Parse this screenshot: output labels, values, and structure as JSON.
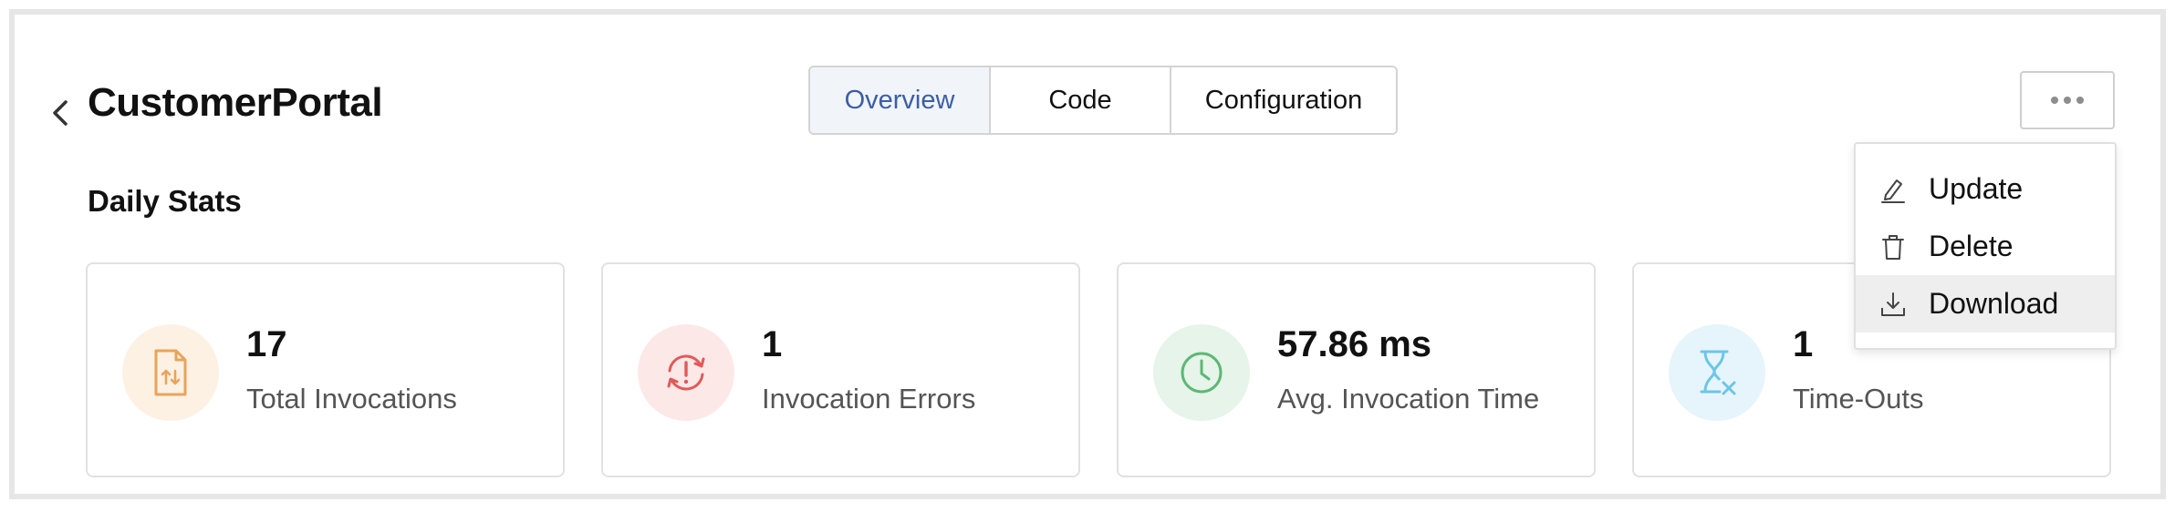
{
  "header": {
    "title": "CustomerPortal"
  },
  "tabs": [
    {
      "label": "Overview",
      "active": true
    },
    {
      "label": "Code",
      "active": false
    },
    {
      "label": "Configuration",
      "active": false
    }
  ],
  "section": {
    "title": "Daily Stats"
  },
  "stats": [
    {
      "value": "17",
      "label": "Total Invocations",
      "icon": "file-transfer-icon",
      "color": "#e8a45a"
    },
    {
      "value": "1",
      "label": "Invocation Errors",
      "icon": "error-refresh-icon",
      "color": "#e05a5a"
    },
    {
      "value": "57.86 ms",
      "label": "Avg. Invocation Time",
      "icon": "clock-icon",
      "color": "#5cb874"
    },
    {
      "value": "1",
      "label": "Time-Outs",
      "icon": "hourglass-x-icon",
      "color": "#6cc6e6"
    }
  ],
  "menu": {
    "items": [
      {
        "label": "Update",
        "icon": "edit-icon"
      },
      {
        "label": "Delete",
        "icon": "trash-icon"
      },
      {
        "label": "Download",
        "icon": "download-icon",
        "highlighted": true
      }
    ]
  }
}
